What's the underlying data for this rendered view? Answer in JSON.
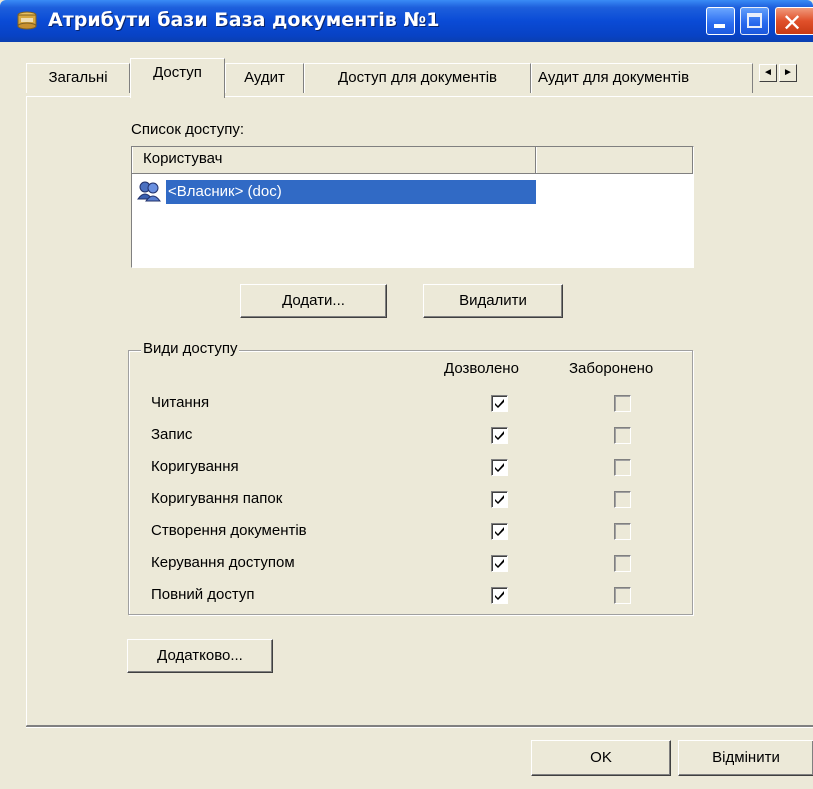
{
  "window": {
    "title": "Атрибути бази База документів №1",
    "title_icon": "database-icon",
    "minimize_icon": "minimize-icon",
    "maximize_icon": "maximize-icon",
    "close_icon": "close-icon",
    "close_glyph": "✕"
  },
  "tabs": [
    {
      "label": "Загальні",
      "active": false
    },
    {
      "label": "Доступ",
      "active": true
    },
    {
      "label": "Аудит",
      "active": false
    },
    {
      "label": "Доступ для документів",
      "active": false
    },
    {
      "label": "Аудит для документів",
      "active": false
    }
  ],
  "tab_scroll": {
    "left_glyph": "◄",
    "right_glyph": "►"
  },
  "access_list": {
    "label": "Список доступу:",
    "columns": [
      "Користувач",
      ""
    ],
    "rows": [
      {
        "user": "<Власник> (doc)",
        "icon": "user-group-icon",
        "selected": true
      }
    ]
  },
  "buttons": {
    "add": "Додати...",
    "remove": "Видалити",
    "advanced": "Додатково...",
    "ok": "OK",
    "cancel": "Відмінити"
  },
  "permissions": {
    "group_title": "Види доступу",
    "allow_header": "Дозволено",
    "deny_header": "Заборонено",
    "items": [
      {
        "label": "Читання",
        "allowed": true,
        "denied": false
      },
      {
        "label": "Запис",
        "allowed": true,
        "denied": false
      },
      {
        "label": "Коригування",
        "allowed": true,
        "denied": false
      },
      {
        "label": "Коригування папок",
        "allowed": true,
        "denied": false
      },
      {
        "label": "Створення документів",
        "allowed": true,
        "denied": false
      },
      {
        "label": "Керування доступом",
        "allowed": true,
        "denied": false
      },
      {
        "label": "Повний доступ",
        "allowed": true,
        "denied": false
      }
    ]
  },
  "colors": {
    "titlebar": "#0a4bd6",
    "dialog_bg": "#ece9d8",
    "selection": "#316ac5",
    "close_button": "#e0502a"
  }
}
